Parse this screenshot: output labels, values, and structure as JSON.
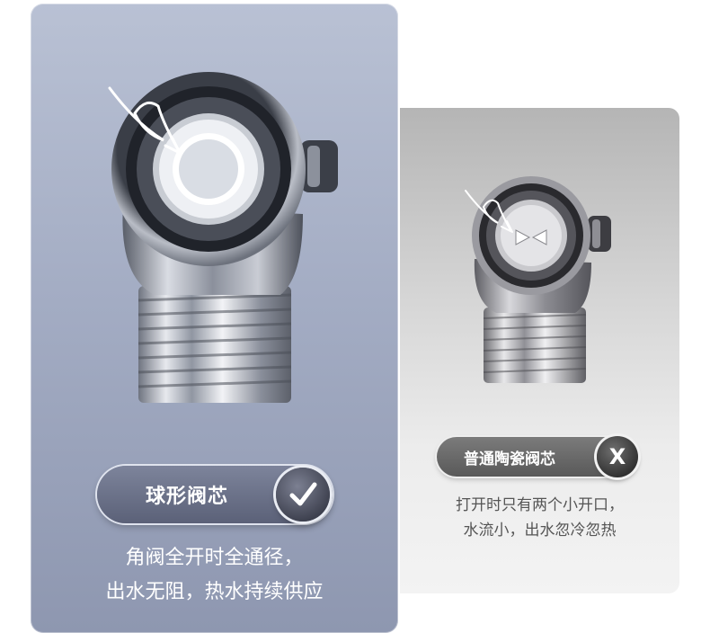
{
  "ball_valve": {
    "title": "球形阀芯",
    "description_line1": "角阀全开时全通径，",
    "description_line2": "出水无阻，热水持续供应",
    "badge_icon": "checkmark-icon"
  },
  "ceramic_valve": {
    "title": "普通陶瓷阀芯",
    "badge_text": "X",
    "description_line1": "打开时只有两个小开口，",
    "description_line2": "水流小，出水忽冷忽热"
  },
  "colors": {
    "left_card": "#a4adc4",
    "right_card": "#d6d6d6",
    "pill_left": "#5b6178",
    "pill_right": "#595959"
  }
}
